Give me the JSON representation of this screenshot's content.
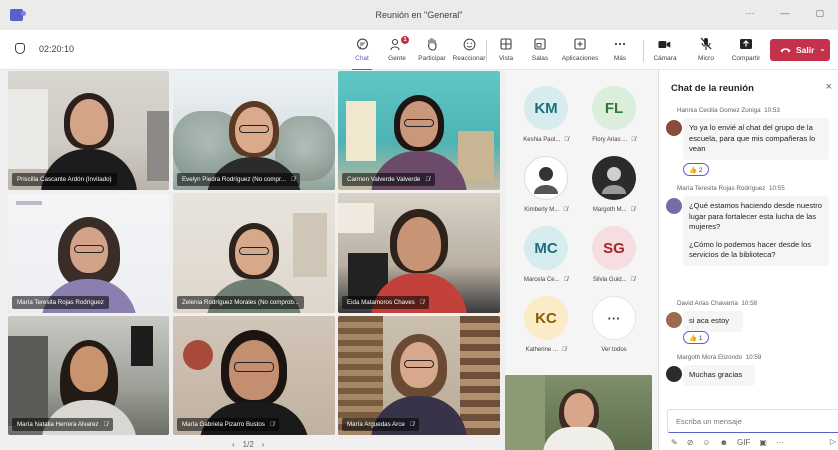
{
  "window": {
    "title": "Reunión en \"General\"",
    "more": "···",
    "minimize": "—",
    "restore": "▢"
  },
  "toolbar": {
    "timer": "02:20:10",
    "items": [
      {
        "label": "Chat",
        "icon": "chat-icon"
      },
      {
        "label": "Gente",
        "icon": "people-icon",
        "badge": "1"
      },
      {
        "label": "Participar",
        "icon": "raise-hand-icon"
      },
      {
        "label": "Reaccionar",
        "icon": "smiley-icon"
      },
      {
        "label": "Vista",
        "icon": "grid-view-icon"
      },
      {
        "label": "Salas",
        "icon": "breakout-rooms-icon"
      },
      {
        "label": "Aplicaciones",
        "icon": "add-apps-icon"
      },
      {
        "label": "Más",
        "icon": "more-icon"
      },
      {
        "label": "Cámara",
        "icon": "camera-icon"
      },
      {
        "label": "Micro",
        "icon": "mic-off-icon"
      },
      {
        "label": "Compartir",
        "icon": "share-icon"
      }
    ],
    "leave_label": "Salir",
    "accent": "#5b5fc7",
    "leave_color": "#c4314b"
  },
  "tiles": [
    {
      "name": "Priscilla Cascante Ardón (Invitado)",
      "muted": false
    },
    {
      "name": "Evelyn Piedra Rodríguez (No compr...",
      "muted": true
    },
    {
      "name": "Carmen Valverde Valverde",
      "muted": true
    },
    {
      "name": "María Teresita Rojas Rodríguez",
      "muted": false
    },
    {
      "name": "Zelenia Rodríguez Morales (No comprob...",
      "muted": false
    },
    {
      "name": "Eida Matamoros Chaves",
      "muted": true
    },
    {
      "name": "María Natalia Herrera Alvarez",
      "muted": true
    },
    {
      "name": "María Gabriela Pizarro Bustos",
      "muted": true
    },
    {
      "name": "María Arguedas Arce",
      "muted": true
    }
  ],
  "pager": {
    "prev": "‹",
    "label": "1/2",
    "next": "›"
  },
  "roster": [
    {
      "initials": "KM",
      "name": "Keshia Paol...",
      "color": "#d6ecef",
      "text_color": "#1b6f7a"
    },
    {
      "initials": "FL",
      "name": "Flory Arias ...",
      "color": "#dbeedc",
      "text_color": "#2b7a37"
    },
    {
      "initials": "",
      "name": "Kimberly M...",
      "color": "#ffffff",
      "text_color": "#000"
    },
    {
      "initials": "",
      "name": "Margoth M...",
      "color": "#333333",
      "text_color": "#fff"
    },
    {
      "initials": "MC",
      "name": "Marcela Ce...",
      "color": "#d6ecef",
      "text_color": "#1b6f7a"
    },
    {
      "initials": "SG",
      "name": "Silvia Guid...",
      "color": "#f5dde0",
      "text_color": "#a4262c"
    },
    {
      "initials": "KC",
      "name": "Katherine ...",
      "color": "#fbecc7",
      "text_color": "#8a5a00"
    },
    {
      "initials": "···",
      "name": "Ver todos",
      "color": "#ffffff",
      "text_color": "#424242"
    }
  ],
  "chat": {
    "title": "Chat de la reunión",
    "close": "×",
    "messages": [
      {
        "author": "Hannia Cecilia Gomez Zuniga",
        "time": "10:53",
        "paragraphs": [
          "Yo ya lo envié al chat del grupo de la escuela, para que mis compañeras lo vean"
        ],
        "reaction": "👍 2"
      },
      {
        "author": "María Teresita Rojas Rodríguez",
        "time": "10:55",
        "paragraphs": [
          "¿Qué estamos haciendo desde nuestro lugar para fortalecer esta lucha de las mujeres?",
          "¿Cómo lo podemos hacer desde los servicios de la biblioteca?"
        ],
        "reaction": ""
      },
      {
        "author": "David Arias Chavarria",
        "time": "10:58",
        "paragraphs": [
          "si aca estoy"
        ],
        "reaction": "👍 1"
      },
      {
        "author": "Margoth Mora Elizondo",
        "time": "10:59",
        "paragraphs": [
          "Muchas gracias"
        ],
        "reaction": ""
      }
    ],
    "compose_placeholder": "Escriba un mensaje",
    "tools": [
      "✎",
      "⊘",
      "☺",
      "☻",
      "GIF",
      "▣",
      "···"
    ],
    "send": "▷"
  }
}
